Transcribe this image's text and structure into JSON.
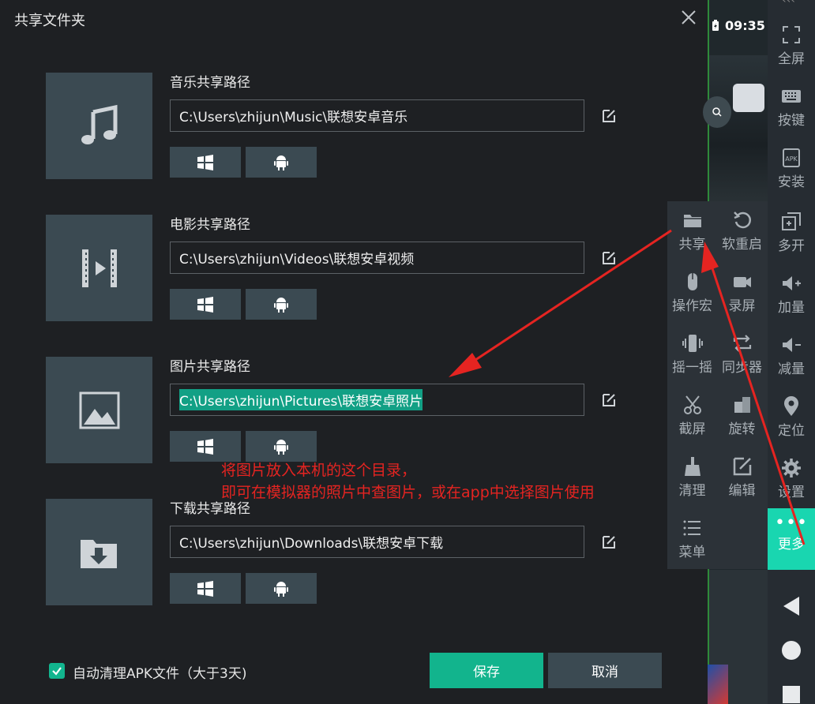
{
  "dialog": {
    "title": "共享文件夹",
    "sections": [
      {
        "label": "音乐共享路径",
        "path": "C:\\Users\\zhijun\\Music\\联想安卓音乐",
        "icon": "music-note-icon"
      },
      {
        "label": "电影共享路径",
        "path": "C:\\Users\\zhijun\\Videos\\联想安卓视频",
        "icon": "film-icon"
      },
      {
        "label": "图片共享路径",
        "path": "C:\\Users\\zhijun\\Pictures\\联想安卓照片",
        "icon": "image-icon"
      },
      {
        "label": "下载共享路径",
        "path": "C:\\Users\\zhijun\\Downloads\\联想安卓下载",
        "icon": "download-folder-icon"
      }
    ],
    "auto_clean_label": "自动清理APK文件（大于3天)",
    "auto_clean_checked": true,
    "save_label": "保存",
    "cancel_label": "取消"
  },
  "annotation": {
    "line1": "将图片放入本机的这个目录，",
    "line2": "即可在模拟器的照片中查图片，或在app中选择图片使用",
    "color": "#e52421"
  },
  "phone": {
    "time": "09:35"
  },
  "toolbar": {
    "items": [
      {
        "label": "全屏",
        "icon": "fullscreen-icon"
      },
      {
        "label": "按键",
        "icon": "keyboard-icon"
      },
      {
        "label": "安装",
        "icon": "apk-icon"
      }
    ],
    "more_label": "更多"
  },
  "more_panel": {
    "items": [
      {
        "label": "共享",
        "icon": "folder-icon"
      },
      {
        "label": "软重启",
        "icon": "restart-icon"
      },
      {
        "label": "多开",
        "icon": "multi-instance-icon"
      },
      {
        "label": "操作宏",
        "icon": "mouse-icon"
      },
      {
        "label": "录屏",
        "icon": "video-camera-icon"
      },
      {
        "label": "加量",
        "icon": "volume-up-icon"
      },
      {
        "label": "摇一摇",
        "icon": "shake-icon"
      },
      {
        "label": "同步器",
        "icon": "sync-icon"
      },
      {
        "label": "减量",
        "icon": "volume-down-icon"
      },
      {
        "label": "截屏",
        "icon": "scissors-icon"
      },
      {
        "label": "旋转",
        "icon": "rotate-icon"
      },
      {
        "label": "定位",
        "icon": "location-pin-icon"
      },
      {
        "label": "清理",
        "icon": "broom-icon"
      },
      {
        "label": "编辑",
        "icon": "edit-icon"
      },
      {
        "label": "设置",
        "icon": "gear-icon"
      },
      {
        "label": "菜单",
        "icon": "menu-icon"
      }
    ]
  },
  "colors": {
    "accent": "#12b48d",
    "more_accent": "#19d6b0",
    "panel": "#3b4a52",
    "background": "#1e2023"
  }
}
